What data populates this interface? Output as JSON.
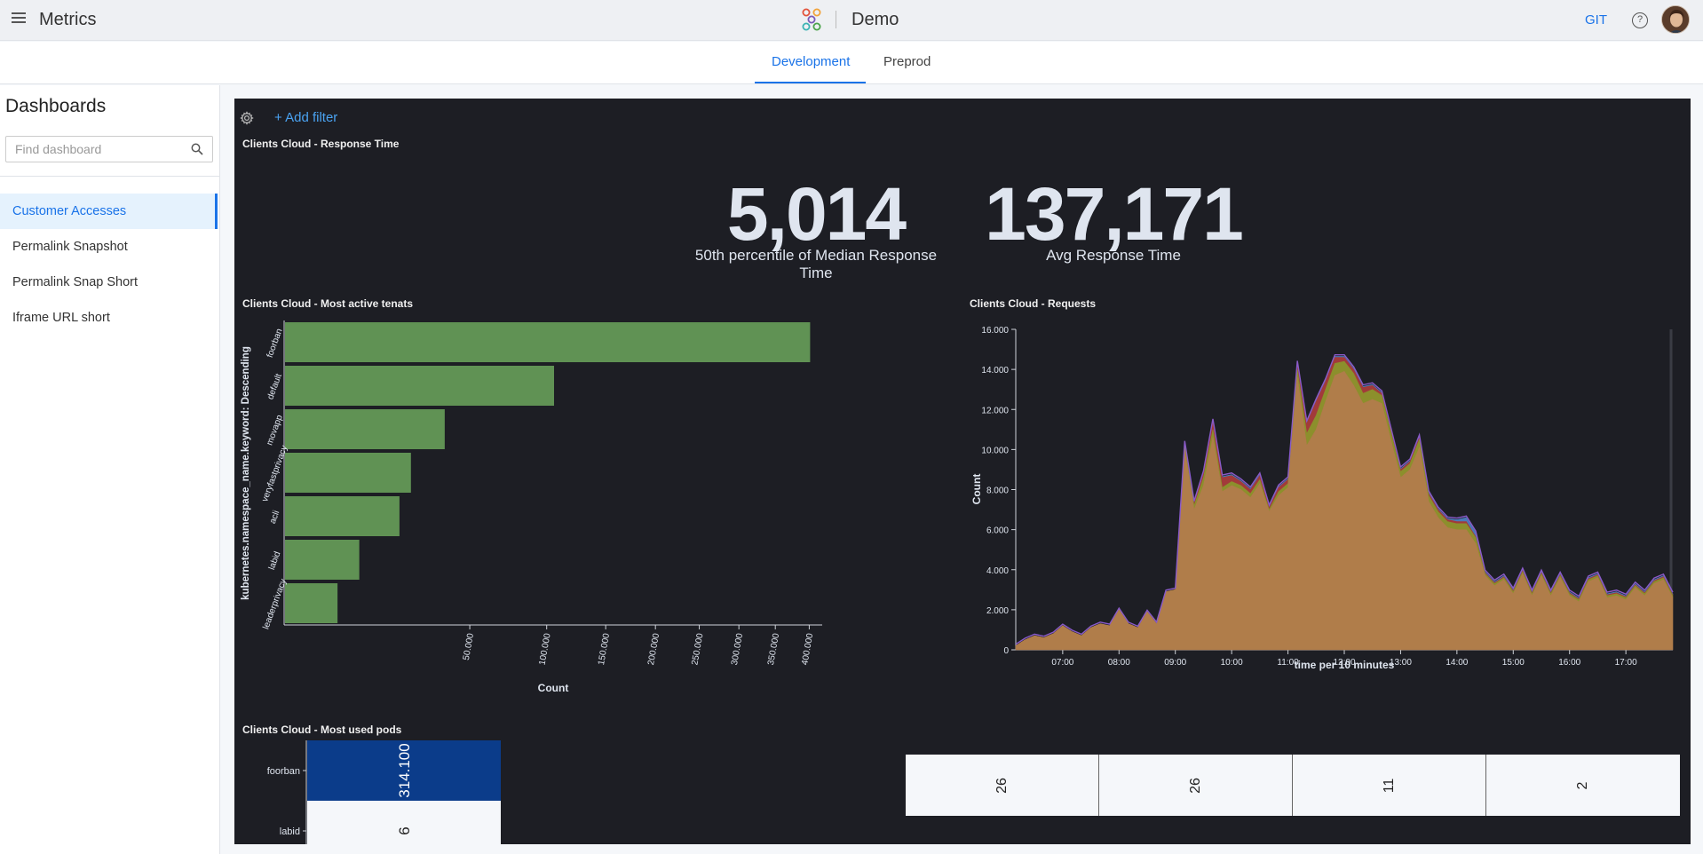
{
  "header": {
    "menu_icon": "hamburger-icon",
    "app_title": "Metrics",
    "workspace_title": "Demo",
    "git_label": "GIT",
    "help_icon": "question-circle-icon",
    "avatar_icon": "user-avatar"
  },
  "tabs": [
    {
      "label": "Development",
      "active": true
    },
    {
      "label": "Preprod",
      "active": false
    }
  ],
  "sidebar": {
    "title": "Dashboards",
    "search_placeholder": "Find dashboard",
    "items": [
      {
        "label": "Customer Accesses",
        "active": true
      },
      {
        "label": "Permalink Snapshot",
        "active": false
      },
      {
        "label": "Permalink Snap Short",
        "active": false
      },
      {
        "label": "Iframe URL short",
        "active": false
      }
    ]
  },
  "dashboard": {
    "add_filter_label": "+ Add filter",
    "response_time": {
      "title": "Clients Cloud - Response Time",
      "metrics": [
        {
          "value": "5,014",
          "label": "50th percentile of Median Response Time"
        },
        {
          "value": "137,171",
          "label": "Avg Response Time"
        }
      ]
    },
    "tenants_title": "Clients Cloud - Most active tenats",
    "requests_title": "Clients Cloud - Requests",
    "pods_title": "Clients Cloud - Most used pods",
    "pods_table": [
      "26",
      "26",
      "11",
      "2"
    ]
  },
  "colors": {
    "accent": "#1a73e8",
    "dashboard_bg": "#1d1e24",
    "bar_green": "#609254",
    "area_orange": "#b07d4a",
    "heatmap_dark": "#0b3c8a"
  },
  "chart_data": [
    {
      "type": "bar",
      "orientation": "horizontal",
      "title": "Clients Cloud - Most active tenats",
      "xlabel": "Count",
      "ylabel": "kubernetes.namespace_name.keyword: Descending",
      "categories": [
        "foorban",
        "default",
        "movapp",
        "veryfastprivacy",
        "acli",
        "labid",
        "leaderprivacy"
      ],
      "values": [
        400000,
        105000,
        37000,
        23000,
        19000,
        8000,
        4000
      ],
      "x_ticks": [
        50000,
        100000,
        150000,
        200000,
        250000,
        300000,
        350000,
        400000
      ],
      "x_tick_labels": [
        "50.000",
        "100.000",
        "150.000",
        "200.000",
        "250.000",
        "300.000",
        "350.000",
        "400.000"
      ],
      "x_scale": "sqrt",
      "xlim": [
        0,
        420000
      ],
      "color": "#609254"
    },
    {
      "type": "area",
      "stacked": true,
      "title": "Clients Cloud - Requests",
      "xlabel": "time per 10 minutes",
      "ylabel": "Count",
      "ylim": [
        0,
        16000
      ],
      "y_ticks": [
        0,
        2000,
        4000,
        6000,
        8000,
        10000,
        12000,
        14000,
        16000
      ],
      "y_tick_labels": [
        "0",
        "2.000",
        "4.000",
        "6.000",
        "8.000",
        "10.000",
        "12.000",
        "14.000",
        "16.000"
      ],
      "x_tick_labels": [
        "07:00",
        "08:00",
        "09:00",
        "10:00",
        "11:00",
        "12:00",
        "13:00",
        "14:00",
        "15:00",
        "16:00",
        "17:00"
      ],
      "x_start": "06:10",
      "x_end": "17:50",
      "x": [
        "06:10",
        "06:20",
        "06:30",
        "06:40",
        "06:50",
        "07:00",
        "07:10",
        "07:20",
        "07:30",
        "07:40",
        "07:50",
        "08:00",
        "08:10",
        "08:20",
        "08:30",
        "08:40",
        "08:50",
        "09:00",
        "09:10",
        "09:20",
        "09:30",
        "09:40",
        "09:50",
        "10:00",
        "10:10",
        "10:20",
        "10:30",
        "10:40",
        "10:50",
        "11:00",
        "11:10",
        "11:20",
        "11:30",
        "11:40",
        "11:50",
        "12:00",
        "12:10",
        "12:20",
        "12:30",
        "12:40",
        "12:50",
        "13:00",
        "13:10",
        "13:20",
        "13:30",
        "13:40",
        "13:50",
        "14:00",
        "14:10",
        "14:20",
        "14:30",
        "14:40",
        "14:50",
        "15:00",
        "15:10",
        "15:20",
        "15:30",
        "15:40",
        "15:50",
        "16:00",
        "16:10",
        "16:20",
        "16:30",
        "16:40",
        "16:50",
        "17:00",
        "17:10",
        "17:20",
        "17:30",
        "17:40",
        "17:50"
      ],
      "series": [
        {
          "color": "#b07d4a",
          "values": [
            200,
            500,
            700,
            600,
            800,
            1200,
            900,
            700,
            1100,
            1300,
            1200,
            2000,
            1300,
            1100,
            1900,
            1300,
            2900,
            3000,
            10000,
            7000,
            8200,
            10600,
            7900,
            8200,
            8000,
            7600,
            8300,
            6900,
            7700,
            8100,
            13600,
            10200,
            11000,
            12400,
            13700,
            13900,
            13200,
            12300,
            12500,
            12300,
            10400,
            8600,
            9000,
            10100,
            7400,
            6600,
            6100,
            6000,
            6000,
            5300,
            3700,
            3200,
            3500,
            2800,
            3800,
            2700,
            3700,
            2700,
            3600,
            2700,
            2400,
            3400,
            3600,
            2600,
            2700,
            2500,
            3100,
            2700,
            3300,
            3500,
            2600
          ]
        },
        {
          "color": "#8c8f2c",
          "values": [
            0,
            0,
            0,
            0,
            0,
            0,
            0,
            0,
            0,
            0,
            0,
            0,
            0,
            0,
            0,
            0,
            0,
            0,
            200,
            200,
            400,
            400,
            200,
            200,
            200,
            200,
            200,
            100,
            200,
            200,
            400,
            600,
            700,
            600,
            600,
            500,
            600,
            500,
            500,
            400,
            400,
            300,
            300,
            400,
            300,
            300,
            300,
            300,
            300,
            300,
            100,
            100,
            100,
            100,
            100,
            100,
            100,
            100,
            100,
            100,
            100,
            100,
            100,
            100,
            100,
            100,
            100,
            100,
            100,
            100,
            100
          ]
        },
        {
          "color": "#a23a3a",
          "values": [
            0,
            0,
            0,
            0,
            0,
            0,
            0,
            0,
            0,
            0,
            0,
            0,
            0,
            0,
            0,
            0,
            0,
            0,
            100,
            100,
            200,
            400,
            500,
            300,
            200,
            200,
            200,
            100,
            200,
            200,
            300,
            500,
            700,
            400,
            300,
            200,
            200,
            300,
            200,
            100,
            100,
            100,
            100,
            100,
            100,
            100,
            100,
            100,
            100,
            50,
            50,
            50,
            50,
            50,
            50,
            50,
            50,
            50,
            50,
            50,
            50,
            50,
            50,
            50,
            50,
            50,
            50,
            50,
            50,
            50,
            50
          ]
        },
        {
          "color": "#4a7ab8",
          "values": [
            0,
            0,
            0,
            0,
            0,
            0,
            0,
            0,
            0,
            0,
            0,
            0,
            0,
            0,
            0,
            0,
            0,
            0,
            50,
            50,
            50,
            50,
            50,
            50,
            50,
            50,
            50,
            50,
            50,
            50,
            50,
            50,
            50,
            50,
            50,
            50,
            50,
            50,
            50,
            50,
            50,
            50,
            50,
            50,
            50,
            50,
            50,
            100,
            200,
            200,
            50,
            50,
            50,
            50,
            50,
            50,
            50,
            50,
            50,
            50,
            50,
            50,
            50,
            50,
            50,
            50,
            50,
            50,
            50,
            50,
            50
          ]
        }
      ]
    },
    {
      "type": "heatmap",
      "title": "Clients Cloud - Most used pods",
      "categories": [
        "foorban",
        "labid"
      ],
      "values": [
        314100,
        6
      ],
      "value_labels": [
        "314.100",
        "6"
      ]
    }
  ]
}
